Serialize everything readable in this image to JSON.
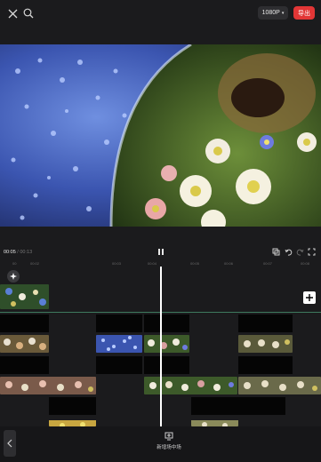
{
  "topbar": {
    "close_icon": "close-icon",
    "search_icon": "search-icon",
    "resolution_label": "1080P",
    "export_label": "导出",
    "accent": "#e23636"
  },
  "playback": {
    "current_time": "00:05",
    "separator": " / ",
    "total_time": "00:13"
  },
  "ruler": {
    "ticks": [
      "00",
      "00:02",
      "00:03",
      "00:04",
      "00:05",
      "00:06",
      "00:07",
      "00:08"
    ]
  },
  "toolbar": {
    "new_scene_label": "新增场中场"
  }
}
